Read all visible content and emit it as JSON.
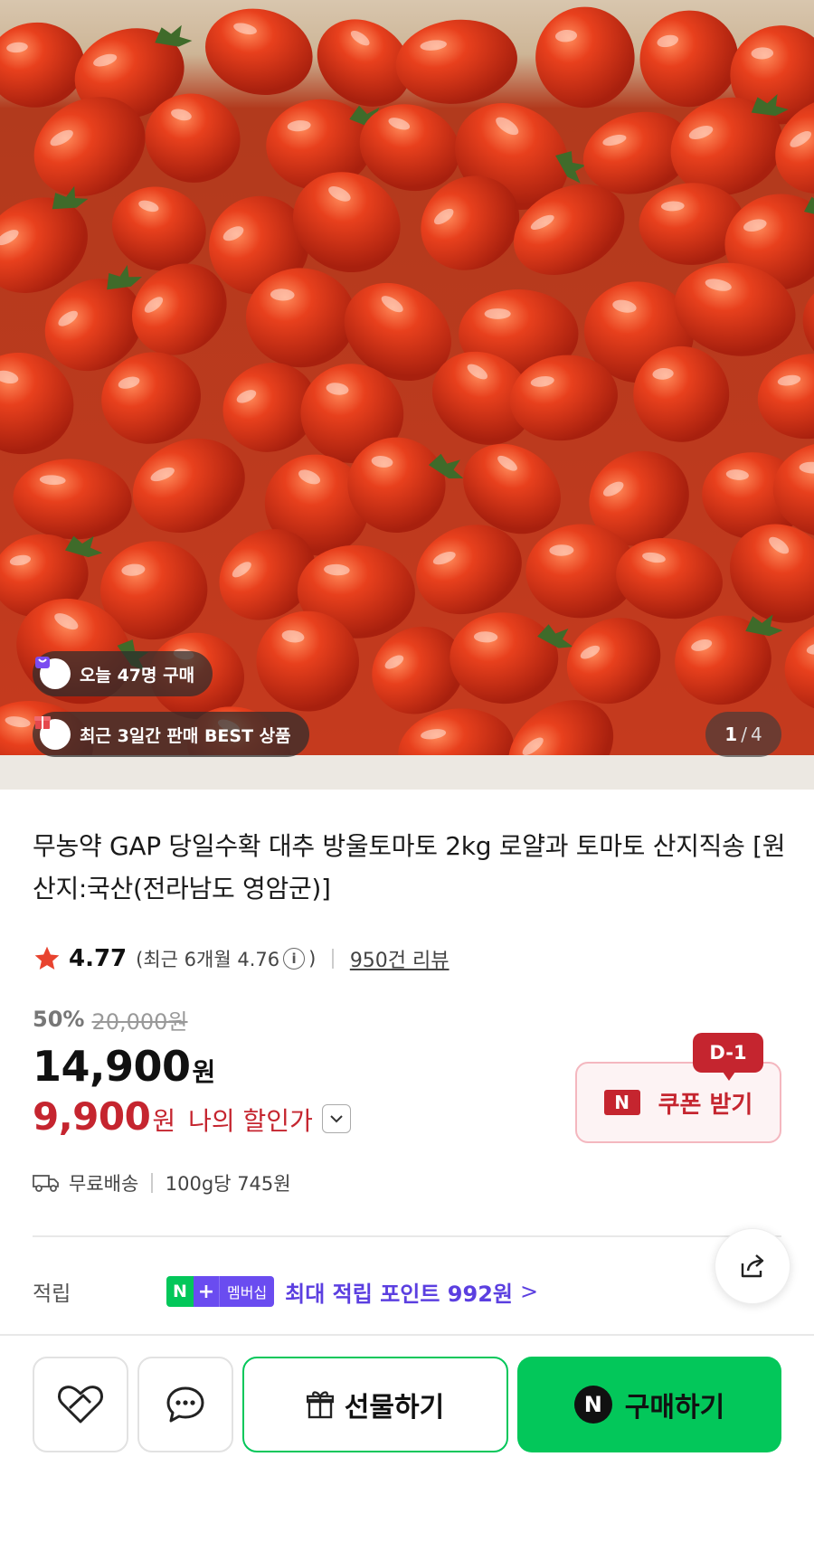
{
  "hero": {
    "badges": {
      "purchases_today": "오늘 47명 구매",
      "best_product": "최근 3일간 판매 BEST 상품"
    },
    "page_counter": {
      "current": "1",
      "separator": "/",
      "total": "4"
    }
  },
  "product": {
    "title": "무농약 GAP 당일수확 대추 방울토마토 2kg 로얄과 토마토 산지직송 [원산지:국산(전라남도 영암군)]",
    "rating": {
      "score": "4.77",
      "recent_prefix": "(최근 6개월 4.76",
      "info_icon_glyph": "i",
      "recent_suffix": ")",
      "reviews": "950건 리뷰"
    },
    "price": {
      "discount_percent": "50%",
      "original_price": "20,000원",
      "sale_price": "14,900",
      "sale_currency": "원",
      "my_price": "9,900",
      "my_price_currency": "원",
      "my_price_label": "나의 할인가"
    },
    "coupon": {
      "dday": "D-1",
      "logo": "N",
      "label": "쿠폰 받기"
    },
    "shipping": {
      "delivery": "무료배송",
      "unit_price": "100g당 745원"
    },
    "points": {
      "label": "적립",
      "badge_n": "N",
      "badge_plus": "+",
      "badge_text": "멤버십",
      "value": "최대 적립 포인트 992원",
      "arrow": ">"
    }
  },
  "bottom_bar": {
    "gift_label": "선물하기",
    "buy_logo": "N",
    "buy_label": "구매하기"
  },
  "colors": {
    "naver_green": "#03c75a",
    "sale_red": "#c5252f",
    "membership_purple": "#6a4cf0"
  }
}
